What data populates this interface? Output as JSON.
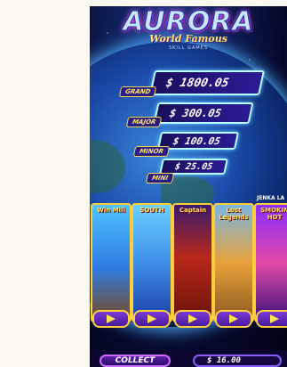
{
  "logo": {
    "title": "AURORA",
    "subtitle": "World Famous",
    "tagline": "SKILL GAMES"
  },
  "jackpots": [
    {
      "label": "GRAND",
      "value": "$ 1800.05"
    },
    {
      "label": "MAJOR",
      "value": "$ 300.05"
    },
    {
      "label": "MINOR",
      "value": "$ 100.05"
    },
    {
      "label": "MINI",
      "value": "$ 25.05"
    }
  ],
  "games": [
    {
      "title": "Win Mill",
      "theme_color": "#3fb6ff"
    },
    {
      "title": "SOUTH",
      "theme_color": "#46a7ff"
    },
    {
      "title": "Captain",
      "theme_color": "#c0351f"
    },
    {
      "title": "Lost Legends",
      "theme_color": "#e8a13a"
    },
    {
      "title": "SMOKIN HOT",
      "theme_color": "#9b2cff"
    }
  ],
  "corner_label": "JENKA LA",
  "bottom": {
    "collect_label": "COLLECT",
    "credit": "$ 16.00"
  }
}
